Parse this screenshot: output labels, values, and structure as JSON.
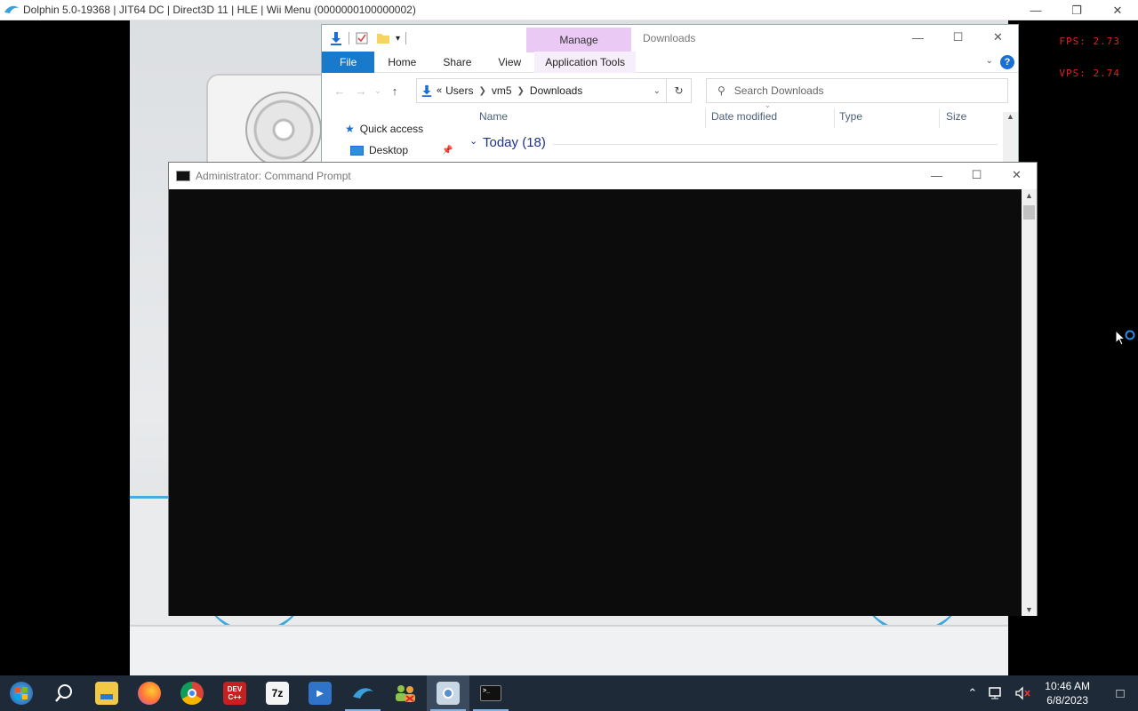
{
  "dolphin": {
    "title": "Dolphin 5.0-19368 | JIT64 DC | Direct3D 11 | HLE | Wii Menu (0000000100000002)",
    "fps": "FPS:  2.73",
    "vps": "VPS:  2.74"
  },
  "explorer": {
    "window_title": "Downloads",
    "contextual_tab": "Manage",
    "ribbon_tabs": [
      "File",
      "Home",
      "Share",
      "View",
      "Application Tools"
    ],
    "breadcrumb": [
      "Users",
      "vm5",
      "Downloads"
    ],
    "search_placeholder": "Search Downloads",
    "columns": [
      "Name",
      "Date modified",
      "Type",
      "Size"
    ],
    "nav_items": [
      "Quick access",
      "Desktop"
    ],
    "group_header": "Today (18)"
  },
  "cmd": {
    "title": "Administrator:  Command Prompt"
  },
  "taskbar": {
    "apps": [
      "start",
      "search",
      "file-explorer",
      "firefox",
      "chrome",
      "dev-cpp",
      "7zip",
      "media",
      "dolphin",
      "people",
      "control-panel",
      "command-prompt"
    ],
    "dev_label": "DEV C++",
    "zip_label": "7z",
    "time": "10:46 AM",
    "date": "6/8/2023"
  },
  "colors": {
    "ribbon_file": "#1979ca",
    "manage_tab": "#eac9f4",
    "fps_text": "#e02020",
    "taskbar": "#1e2a38"
  }
}
